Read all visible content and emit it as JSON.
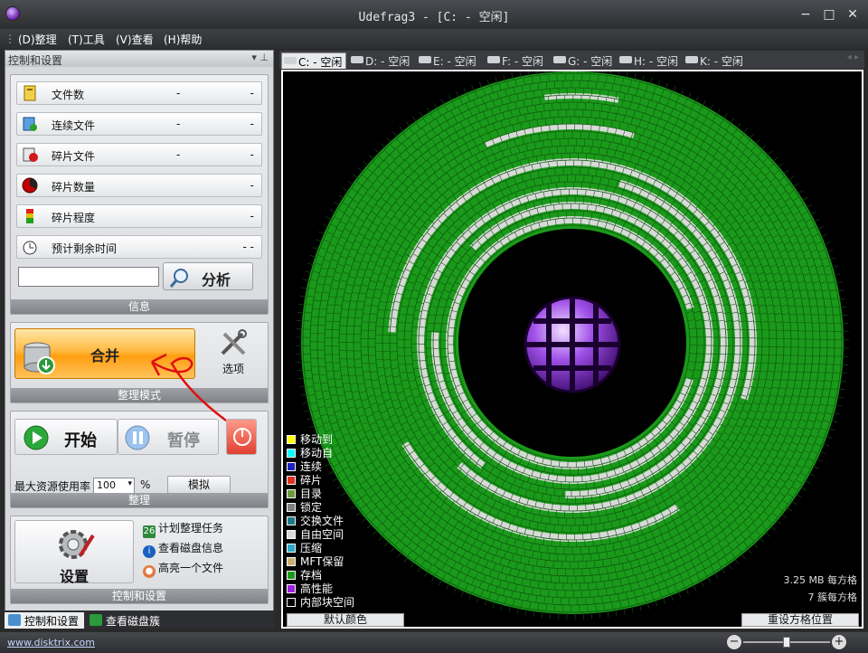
{
  "window": {
    "title": "Udefrag3 - [C: - 空闲]",
    "controls": [
      "−",
      "□",
      "✕"
    ]
  },
  "menu": [
    "(D)整理",
    "(T)工具",
    "(V)查看",
    "(H)帮助"
  ],
  "panel": {
    "title": "控制和设置",
    "pin": "▾  ⊥"
  },
  "stats": [
    {
      "label": "文件数",
      "v1": "-",
      "v2": "-",
      "icon": "files-icon",
      "color": "#d4b000"
    },
    {
      "label": "连续文件",
      "v1": "-",
      "v2": "-",
      "icon": "contiguous-files-icon",
      "color": "#1e88c8"
    },
    {
      "label": "碎片文件",
      "v1": "-",
      "v2": "-",
      "icon": "fragmented-files-icon",
      "color": "#d01818"
    },
    {
      "label": "碎片数量",
      "v1": "",
      "v2": "-",
      "icon": "fragments-count-icon",
      "color": "#c00000"
    },
    {
      "label": "碎片程度",
      "v1": "",
      "v2": "-",
      "icon": "fragmentation-level-icon",
      "color": "#e0a000"
    },
    {
      "label": "预计剩余时间",
      "v1": "",
      "v2": "- -",
      "icon": "timer-icon",
      "color": "#3a8a3a"
    }
  ],
  "info": {
    "analyze_label": "分析",
    "caption": "信息"
  },
  "mode": {
    "merge_label": "合并",
    "options_label": "选项",
    "caption": "整理模式"
  },
  "control": {
    "start_label": "开始",
    "pause_label": "暂停",
    "resource_label": "最大资源使用率",
    "resource_value": "100",
    "percent": "%",
    "simulate_label": "模拟",
    "caption": "整理"
  },
  "settings": {
    "settings_label": "设置",
    "caption": "控制和设置",
    "links": [
      "计划整理任务",
      "查看磁盘信息",
      "高亮一个文件"
    ]
  },
  "bottom_tabs": [
    "控制和设置",
    "查看磁盘簇"
  ],
  "drive_tabs": [
    "C: - 空闲",
    "D: - 空闲",
    "E: - 空闲",
    "F: - 空闲",
    "G: - 空闲",
    "H: - 空闲",
    "K: - 空闲"
  ],
  "legend": [
    {
      "label": "移动到",
      "color": "#ffff00"
    },
    {
      "label": "移动自",
      "color": "#00ffff"
    },
    {
      "label": "连续",
      "color": "#2020c0"
    },
    {
      "label": "碎片",
      "color": "#e03020"
    },
    {
      "label": "目录",
      "color": "#6a9a3a"
    },
    {
      "label": "锁定",
      "color": "#808080"
    },
    {
      "label": "交换文件",
      "color": "#1a7a8a"
    },
    {
      "label": "自由空间",
      "color": "#d9d9d9"
    },
    {
      "label": "压缩",
      "color": "#2aa8c8"
    },
    {
      "label": "MFT保留",
      "color": "#c8b070"
    },
    {
      "label": "存档",
      "color": "#1a9a1a"
    },
    {
      "label": "高性能",
      "color": "#a020e0"
    },
    {
      "label": "内部块空间",
      "color": "#000000"
    }
  ],
  "map": {
    "default_colors_label": "默认颜色",
    "reset_grid_label": "重设方格位置",
    "scale1": "3.25 MB 每方格",
    "scale2": "7 簇每方格"
  },
  "status": {
    "site": "www.disktrix.com"
  }
}
